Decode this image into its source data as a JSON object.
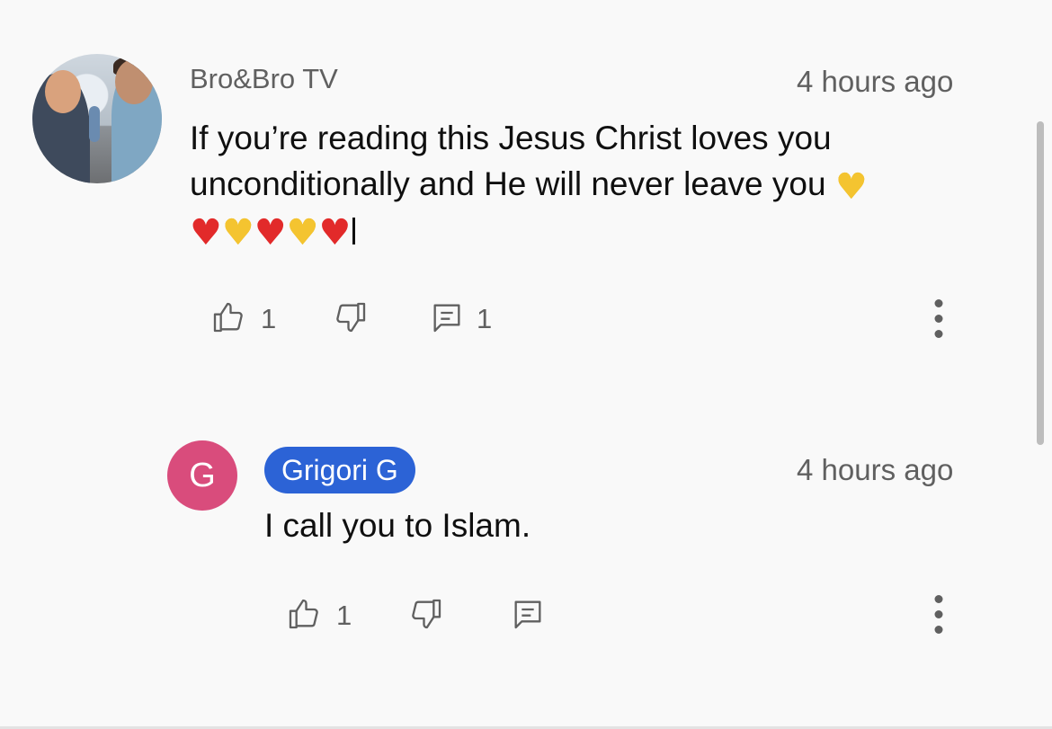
{
  "comments": [
    {
      "author": "Bro&Bro TV",
      "time": "4 hours ago",
      "text_line1": "If you’re reading this Jesus Christ loves you",
      "text_line2": "unconditionally and He will never leave you",
      "emojis_line2": [
        "yellow-heart"
      ],
      "emojis_line3": [
        "red-heart",
        "yellow-heart",
        "red-heart",
        "yellow-heart",
        "red-heart"
      ],
      "likes": "1",
      "replies": "1",
      "emoji_glyphs": {
        "red_heart": "❤️",
        "yellow_heart": "♥"
      }
    },
    {
      "author": "Grigori G",
      "avatar_letter": "G",
      "time": "4 hours ago",
      "text": "I call you to Islam.",
      "likes": "1"
    }
  ],
  "colors": {
    "background": "#f9f9f9",
    "secondary_text": "#606060",
    "author_chip": "#2c63d6",
    "letter_avatar": "#d94c7c",
    "red_heart": "#e22a2a",
    "yellow_heart": "#f4c430"
  },
  "icons": [
    "thumbs-up-icon",
    "thumbs-down-icon",
    "reply-icon",
    "more-vert-icon"
  ]
}
